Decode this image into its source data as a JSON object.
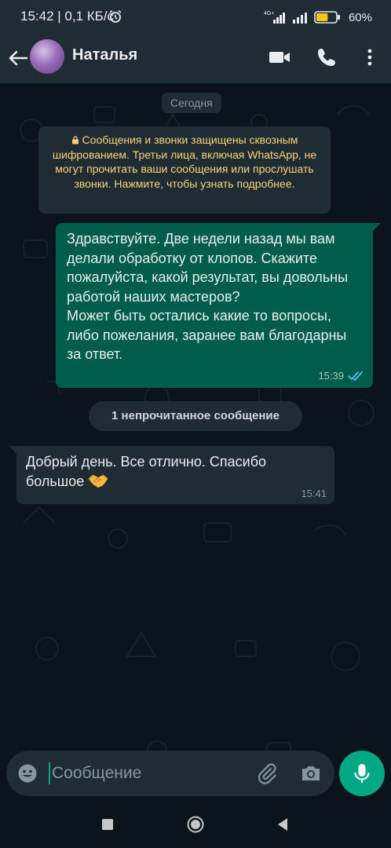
{
  "status_bar": {
    "time_speed": "15:42 | 0,1 КБ/с",
    "network_label": "4G+",
    "battery_percent": "60%",
    "battery_level": 0.6
  },
  "header": {
    "contact_name": "Наталья"
  },
  "chat": {
    "date_label": "Сегодня",
    "encryption_notice": "Сообщения и звонки защищены сквозным шифрованием. Третьи лица, включая WhatsApp, не могут прочитать ваши сообщения или прослушать звонки. Нажмите, чтобы узнать подробнее.",
    "messages": [
      {
        "direction": "outgoing",
        "text": "Здравствуйте. Две недели назад мы вам делали обработку от клопов. Скажите пожалуйста, какой результат, вы довольны работой наших мастеров?\nМожет быть остались какие то вопросы, либо пожелания, заранее вам благодарны за ответ.",
        "time": "15:39",
        "status": "read"
      },
      {
        "direction": "incoming",
        "text": "Добрый день. Все отлично. Спасибо большое",
        "emoji": "handshake-emoji",
        "time": "15:41"
      }
    ],
    "unread_label": "1 непрочитанное сообщение"
  },
  "input": {
    "placeholder": "Сообщение"
  },
  "colors": {
    "background": "#0b141a",
    "bar": "#1f2c34",
    "outgoing_bubble": "#005c4b",
    "incoming_bubble": "#1f2c34",
    "accent": "#00a884",
    "encryption_text": "#ffd279",
    "read_ticks": "#53bdeb"
  }
}
